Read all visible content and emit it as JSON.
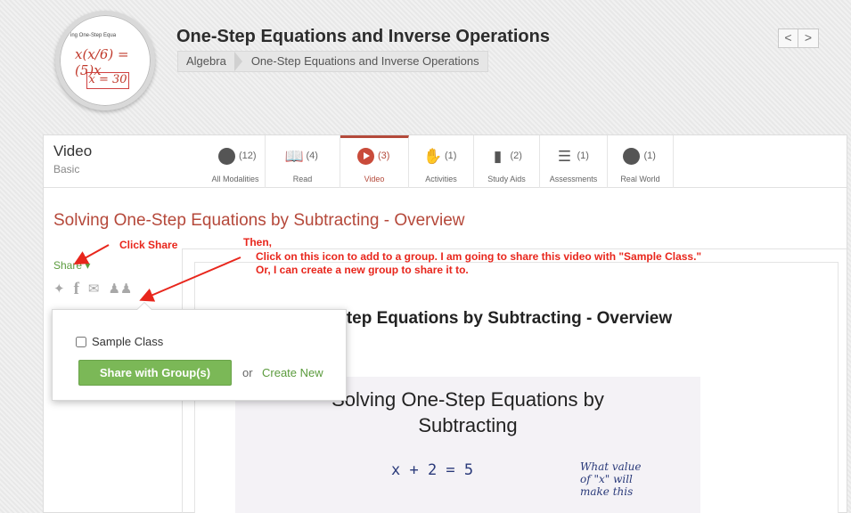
{
  "header": {
    "title": "One-Step Equations and Inverse Operations",
    "thumb_title": "ing One-Step Equa",
    "thumb_eq": "x(x/6) = (5)x",
    "thumb_box": "x = 30",
    "breadcrumb": [
      "Algebra",
      "One-Step Equations and Inverse Operations"
    ],
    "pager_prev": "<",
    "pager_next": ">"
  },
  "modality": {
    "title": "Video",
    "level": "Basic",
    "tabs": [
      {
        "label": "All Modalities",
        "count": "(12)",
        "icon": "lightbulb-icon"
      },
      {
        "label": "Read",
        "count": "(4)",
        "icon": "book-icon"
      },
      {
        "label": "Video",
        "count": "(3)",
        "icon": "play-icon"
      },
      {
        "label": "Activities",
        "count": "(1)",
        "icon": "hand-icon"
      },
      {
        "label": "Study Aids",
        "count": "(2)",
        "icon": "documents-icon"
      },
      {
        "label": "Assessments",
        "count": "(1)",
        "icon": "checklist-icon"
      },
      {
        "label": "Real World",
        "count": "(1)",
        "icon": "globe-icon"
      }
    ]
  },
  "resource": {
    "title": "Solving One-Step Equations by Subtracting - Overview",
    "share_label": "Share ▾",
    "video_heading": "Solving One-Step Equations by Subtracting - Overview",
    "video_line1": "Solving One-Step Equations by",
    "video_line2": "Subtracting",
    "video_eq": "x + 2  =  5",
    "video_note": "What value of \"x\" will make this"
  },
  "popover": {
    "checkbox_label": "Sample Class",
    "share_button": "Share with Group(s)",
    "or_text": "or",
    "create_new": "Create New"
  },
  "annotations": {
    "click_share": "Click Share",
    "then": "Then,",
    "line1": "Click on this icon to add to a group.  I am going to share this video with \"Sample Class.\"",
    "line2": "Or, I can create a new group to share it to."
  },
  "colors": {
    "accent": "#b5483a",
    "green": "#7bb857",
    "annotation": "#e8261c"
  }
}
